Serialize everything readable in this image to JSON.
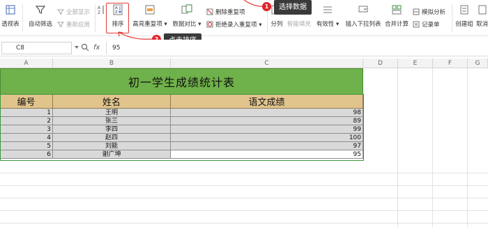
{
  "ribbon": {
    "pivot": "透视表",
    "autofilter": "自动筛选",
    "show_all": "全部显示",
    "reapply": "重新应用",
    "sort": "排序",
    "highlight_dup": "高亮重复项",
    "data_compare": "数据对比",
    "delete_dup": "删除重复项",
    "reject_dup": "拒绝录入重复项",
    "split": "分列",
    "smart_fill": "智能填充",
    "validity": "有效性",
    "insert_dropdown": "插入下拉列表",
    "consolidate": "合并计算",
    "simulation": "模拟分析",
    "record": "记录单",
    "create_group": "创建组",
    "ungroup": "取消"
  },
  "callouts": {
    "step1_num": "1",
    "step1_text": "选择数据",
    "step2_num": "2",
    "step2_text": "点击排序"
  },
  "formula_bar": {
    "cell_ref": "C8",
    "fx": "fx",
    "value": "95"
  },
  "sheet": {
    "columns": [
      "A",
      "B",
      "C",
      "D",
      "E",
      "F",
      "G"
    ],
    "title": "初一学生成绩统计表",
    "headers": [
      "编号",
      "姓名",
      "语文成绩"
    ],
    "rows": [
      {
        "id": "1",
        "name": "王明",
        "score": "98"
      },
      {
        "id": "2",
        "name": "张三",
        "score": "89"
      },
      {
        "id": "3",
        "name": "李四",
        "score": "99"
      },
      {
        "id": "4",
        "name": "赵四",
        "score": "100"
      },
      {
        "id": "5",
        "name": "刘能",
        "score": "97"
      },
      {
        "id": "6",
        "name": "谢广坤",
        "score": "95"
      }
    ]
  },
  "colors": {
    "title_fill": "#6fb14a",
    "header_fill": "#e1c48c",
    "data_fill": "#d9d9d9",
    "callout_badge": "#e0252b",
    "callout_tip": "#3a3a3a"
  }
}
